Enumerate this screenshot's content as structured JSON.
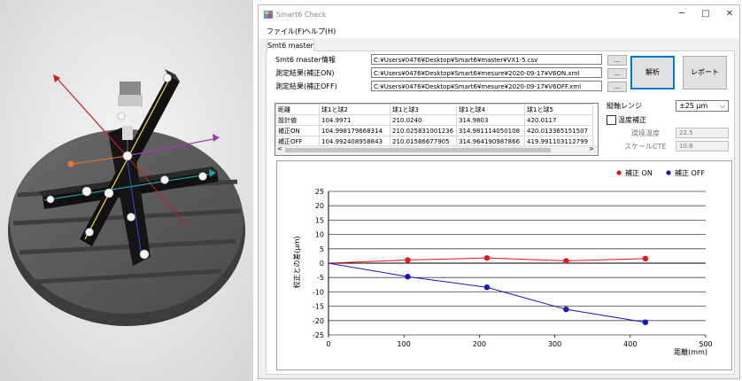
{
  "window": {
    "title": "Smart6 Check",
    "controls": {
      "minimize": "─",
      "maximize": "□",
      "close": "✕"
    }
  },
  "menu": {
    "file": "ファイル(F)",
    "help": "ヘルプ(H)"
  },
  "tab": {
    "label": "Smt6 master"
  },
  "fields": [
    {
      "label": "Smt6 master情報",
      "value": "C:¥Users¥0476¥Desktop¥Smart6¥master¥VX1-5.csv"
    },
    {
      "label": "測定結果(補正ON)",
      "value": "C:¥Users¥0476¥Desktop¥Smart6¥mesure¥2020-09-17¥V6ON.xml"
    },
    {
      "label": "測定結果(補正OFF)",
      "value": "C:¥Users¥0476¥Desktop¥Smart6¥mesure¥2020-09-17¥V6OFF.xml"
    }
  ],
  "browse_label": "...",
  "buttons": {
    "analyze": "解析",
    "report": "レポート"
  },
  "table": {
    "headers": [
      "距離",
      "球1と球2",
      "球1と球3",
      "球1と球4",
      "球1と球5"
    ],
    "rows": [
      [
        "設計値",
        "104.9971",
        "210.0240",
        "314.9803",
        "420.0117"
      ],
      [
        "補正ON",
        "104.998179668314",
        "210.025831001236",
        "314.981114050108",
        "420.013365151507"
      ],
      [
        "補正OFF",
        "104.992408958843",
        "210.01586677905",
        "314.964190987866",
        "419.991103112799"
      ]
    ]
  },
  "scroll": {
    "left": "<",
    "right": ">"
  },
  "right_panel": {
    "range_label": "縦軸レンジ",
    "range_value": "±25 μm",
    "dropdown_arrow": "⌵",
    "temp_label": "温度補正",
    "ambient_label": "環境温度",
    "ambient_value": "22.5",
    "scale_label": "スケールCTE",
    "scale_value": "10.8"
  },
  "chart_data": {
    "type": "line",
    "xlabel": "距離(mm)",
    "ylabel": "校正との差(μm)",
    "xlim": [
      0,
      500
    ],
    "ylim": [
      -25,
      25
    ],
    "xticks": [
      0,
      100,
      200,
      300,
      400,
      500
    ],
    "yticks": [
      25,
      20,
      15,
      10,
      5,
      0,
      -5,
      -10,
      -15,
      -20,
      -25
    ],
    "grid": true,
    "legend_position": "top-right",
    "series": [
      {
        "name": "補正 ON",
        "color": "#e8141b",
        "x": [
          0,
          105,
          210,
          315,
          420
        ],
        "y": [
          0,
          1.1,
          1.8,
          0.8,
          1.6
        ]
      },
      {
        "name": "補正 OFF",
        "color": "#1414cc",
        "x": [
          0,
          105,
          210,
          315,
          420
        ],
        "y": [
          0,
          -4.7,
          -8.4,
          -16.1,
          -20.6
        ]
      }
    ]
  }
}
